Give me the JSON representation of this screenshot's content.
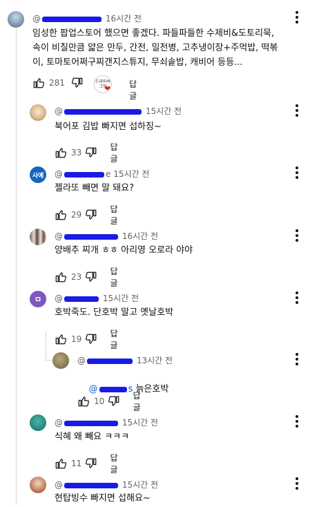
{
  "top_comment": {
    "handle_prefix": "@",
    "time": "16시간 전",
    "text": "임성한 팝업스토어 했으면 좋겠다. 파들파들한 수제비&도토리묵,\n속이 비칠만큼 얇은 만두, 간전, 밀전병, 고추냉이장+주먹밥, 떡볶\n이, 토마토어쩌구찌갠지스튜지, 무쇠솥밥, 캐비어 등등...",
    "likes": "281",
    "reply_label": "답글",
    "creator_badge_text": "드라마속 그하"
  },
  "replies": [
    {
      "handle_prefix": "@",
      "time": "15시간 전",
      "text": "북어포 김밥 빠지면 섭하징~",
      "likes": "33",
      "reply_label": "답글",
      "avatar_text": ""
    },
    {
      "handle_prefix": "@",
      "handle_suffix": "e",
      "time": "15시간 전",
      "text": "젤라또 빼면 말 돼요?",
      "likes": "29",
      "reply_label": "답글",
      "avatar_text": "사예"
    },
    {
      "handle_prefix": "@",
      "time": "16시간 전",
      "text": "양배추 찌개 ㅎㅎ 아리영 오로라 야야",
      "likes": "23",
      "reply_label": "답글",
      "avatar_text": ""
    },
    {
      "handle_prefix": "@",
      "time": "15시간 전",
      "text": "호박죽도. 단호박 말고 옛날호박",
      "likes": "19",
      "reply_label": "답글",
      "avatar_text": "ㅁ"
    },
    {
      "handle_prefix": "@",
      "time": "13시간 전",
      "mention_prefix": "@",
      "mention_suffix": "s",
      "text": " 늙은호박",
      "likes": "10",
      "reply_label": "답글",
      "avatar_text": ""
    },
    {
      "handle_prefix": "@",
      "time": "15시간 전",
      "text": "식혜 왜 빼요 ㅋㅋㅋ",
      "likes": "11",
      "reply_label": "답글",
      "avatar_text": ""
    },
    {
      "handle_prefix": "@",
      "time": "15시간 전",
      "text": "현탑빙수 빠지면 섭해요~",
      "likes": "",
      "reply_label": "",
      "avatar_text": ""
    }
  ],
  "colors": {
    "redaction": "#1a1ae6",
    "mention": "#065fd4",
    "secondary_text": "#606060",
    "heart": "#e61c2c"
  },
  "icons": [
    "like-icon",
    "dislike-icon",
    "more-vert-icon",
    "heart-icon"
  ]
}
